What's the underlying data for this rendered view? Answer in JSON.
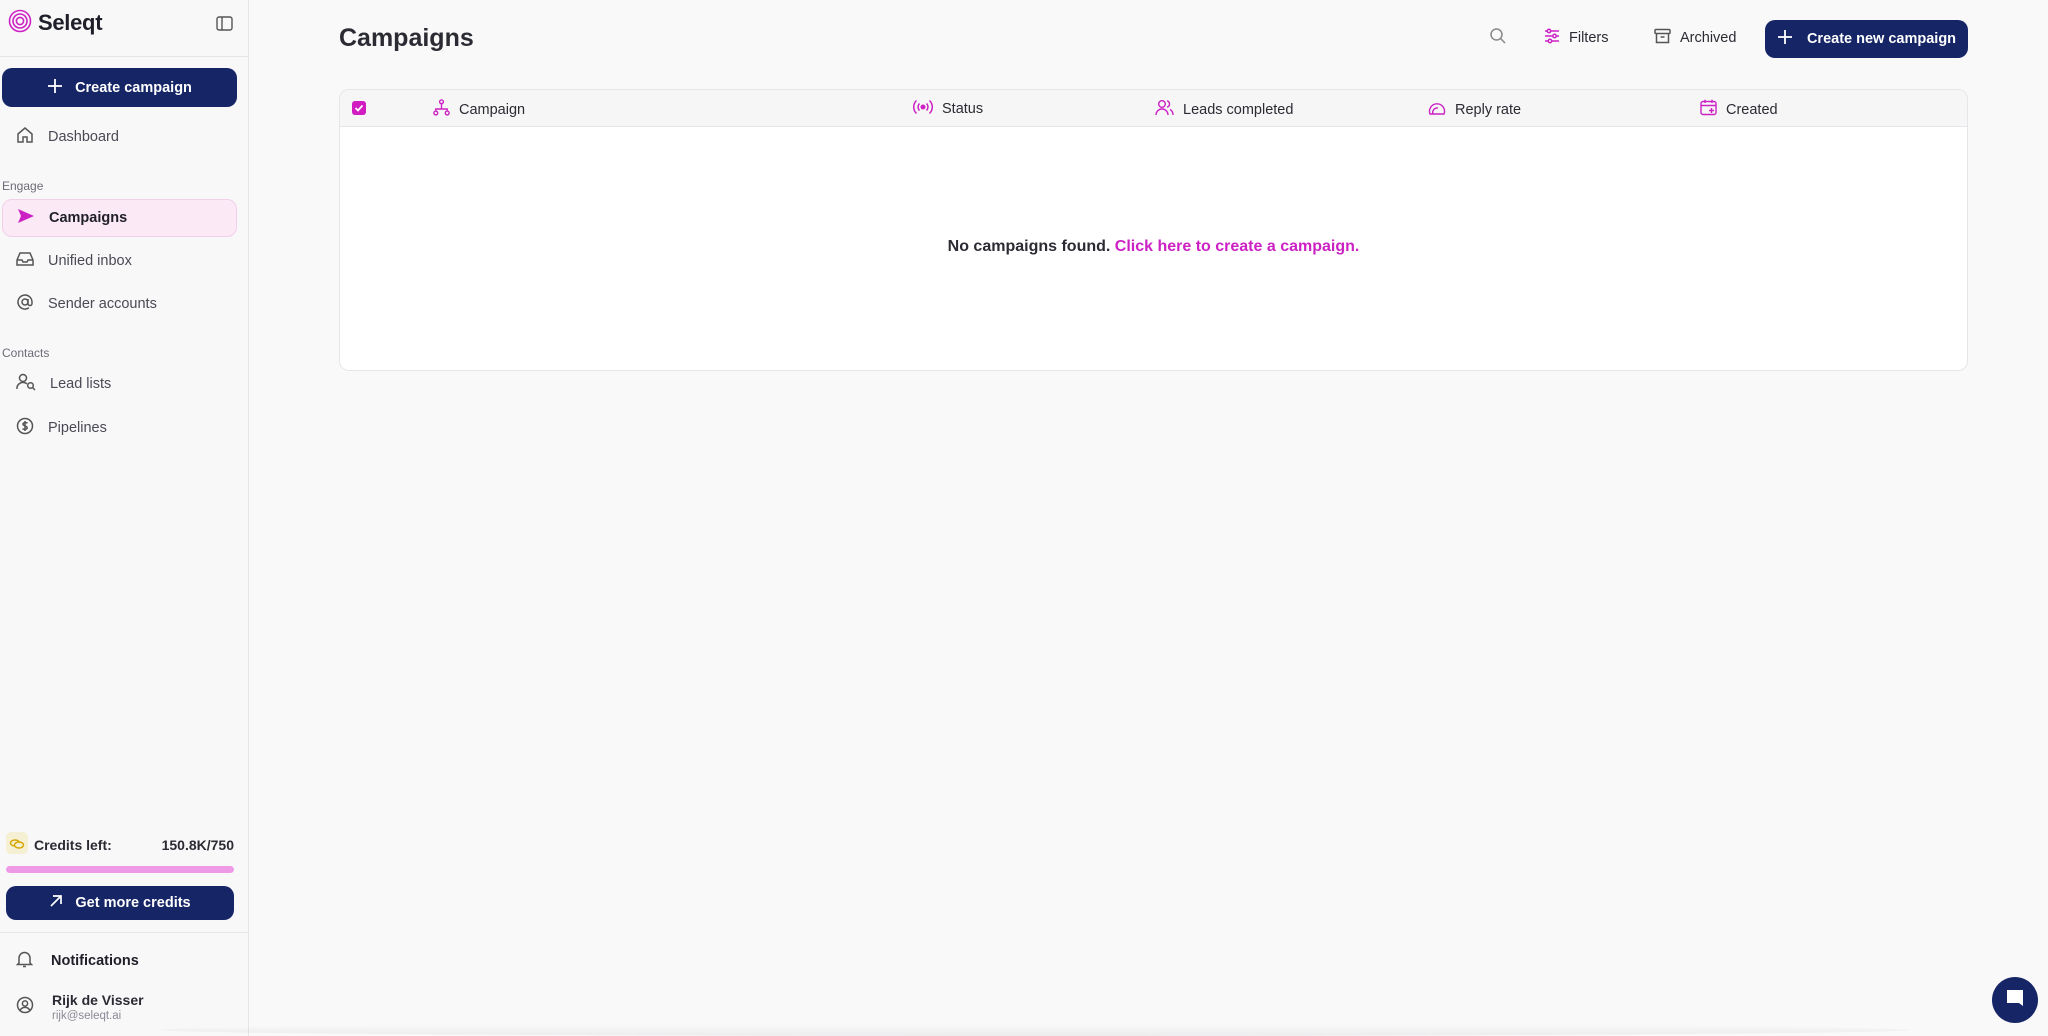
{
  "brand": {
    "name": "Seleqt"
  },
  "sidebar": {
    "create_label": "Create campaign",
    "dashboard_label": "Dashboard",
    "section_engage": "Engage",
    "campaigns_label": "Campaigns",
    "inbox_label": "Unified inbox",
    "senders_label": "Sender accounts",
    "section_contacts": "Contacts",
    "leads_label": "Lead lists",
    "pipelines_label": "Pipelines"
  },
  "credits": {
    "label": "Credits left:",
    "value": "150.8K/750",
    "fill_fraction": 1.0,
    "cta_label": "Get more credits"
  },
  "footer": {
    "notifications_label": "Notifications",
    "user_name": "Rijk de Visser",
    "user_email": "rijk@seleqt.ai"
  },
  "header": {
    "title": "Campaigns",
    "filters_label": "Filters",
    "archived_label": "Archived",
    "new_campaign_label": "Create new campaign"
  },
  "table": {
    "columns": [
      "Campaign",
      "Status",
      "Leads completed",
      "Reply rate",
      "Created"
    ],
    "empty_text": "No campaigns found.",
    "empty_link": "Click here to create a campaign."
  },
  "colors": {
    "navy": "#152566",
    "accent": "#cc22c4",
    "active_bg": "#fbeaf6"
  }
}
